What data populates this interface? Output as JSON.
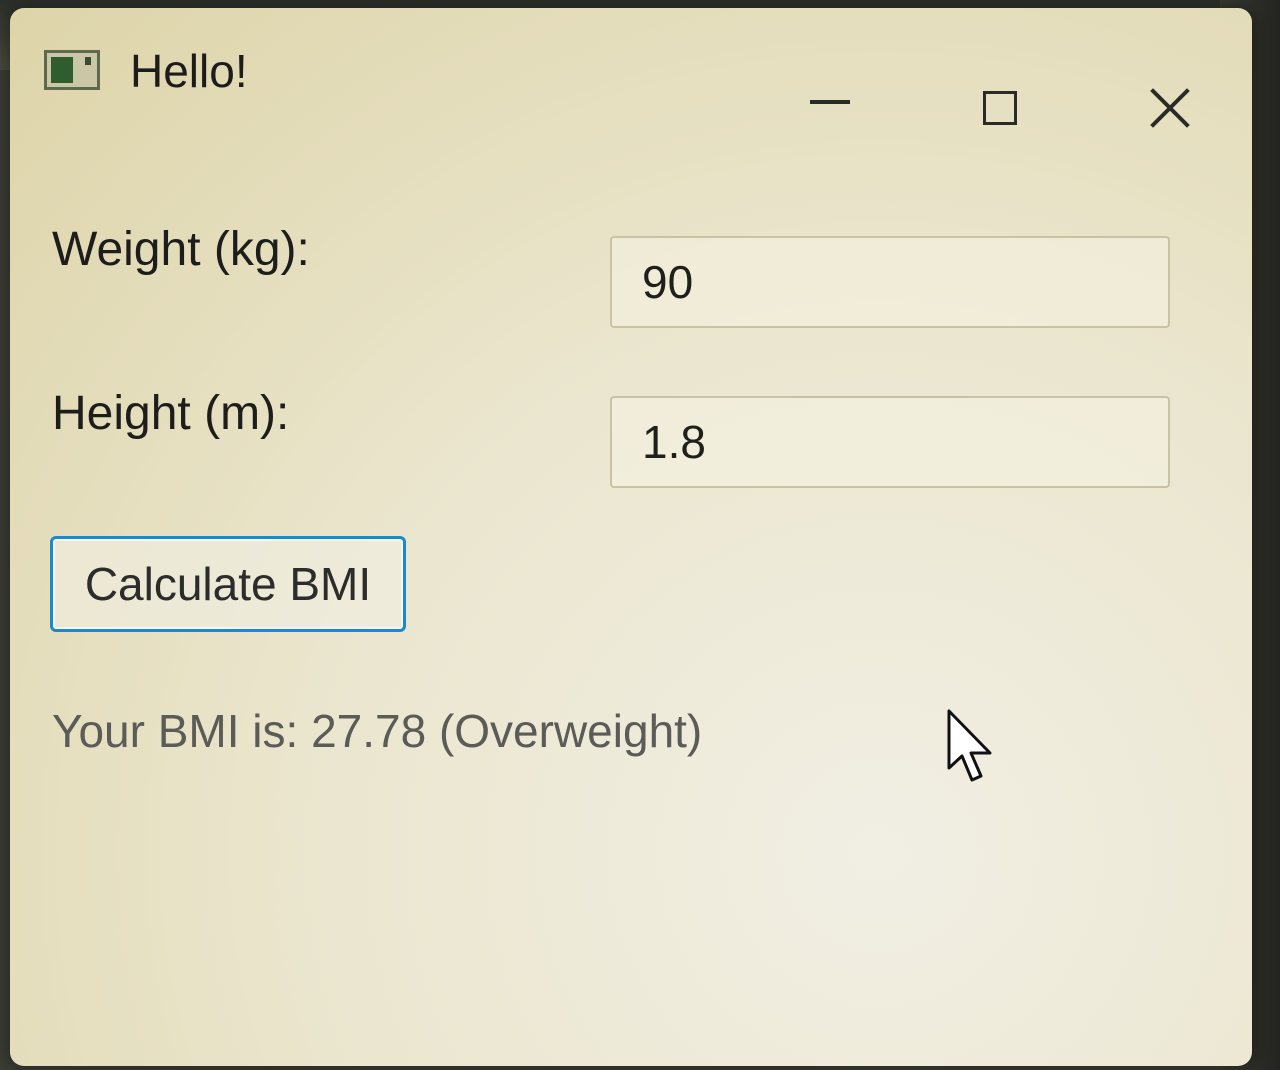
{
  "window": {
    "title": "Hello!",
    "controls": {
      "minimize": "minimize-icon",
      "maximize": "maximize-icon",
      "close": "close-icon"
    }
  },
  "form": {
    "weight_label": "Weight (kg):",
    "weight_value": "90",
    "height_label": "Height (m):",
    "height_value": "1.8",
    "calculate_label": "Calculate BMI",
    "result_text": "Your BMI is: 27.78 (Overweight)"
  },
  "colors": {
    "button_focus_border": "#1a8ad0",
    "window_background": "#ece8d4",
    "text": "#1d1d1b",
    "result_text": "#5b5b57"
  }
}
